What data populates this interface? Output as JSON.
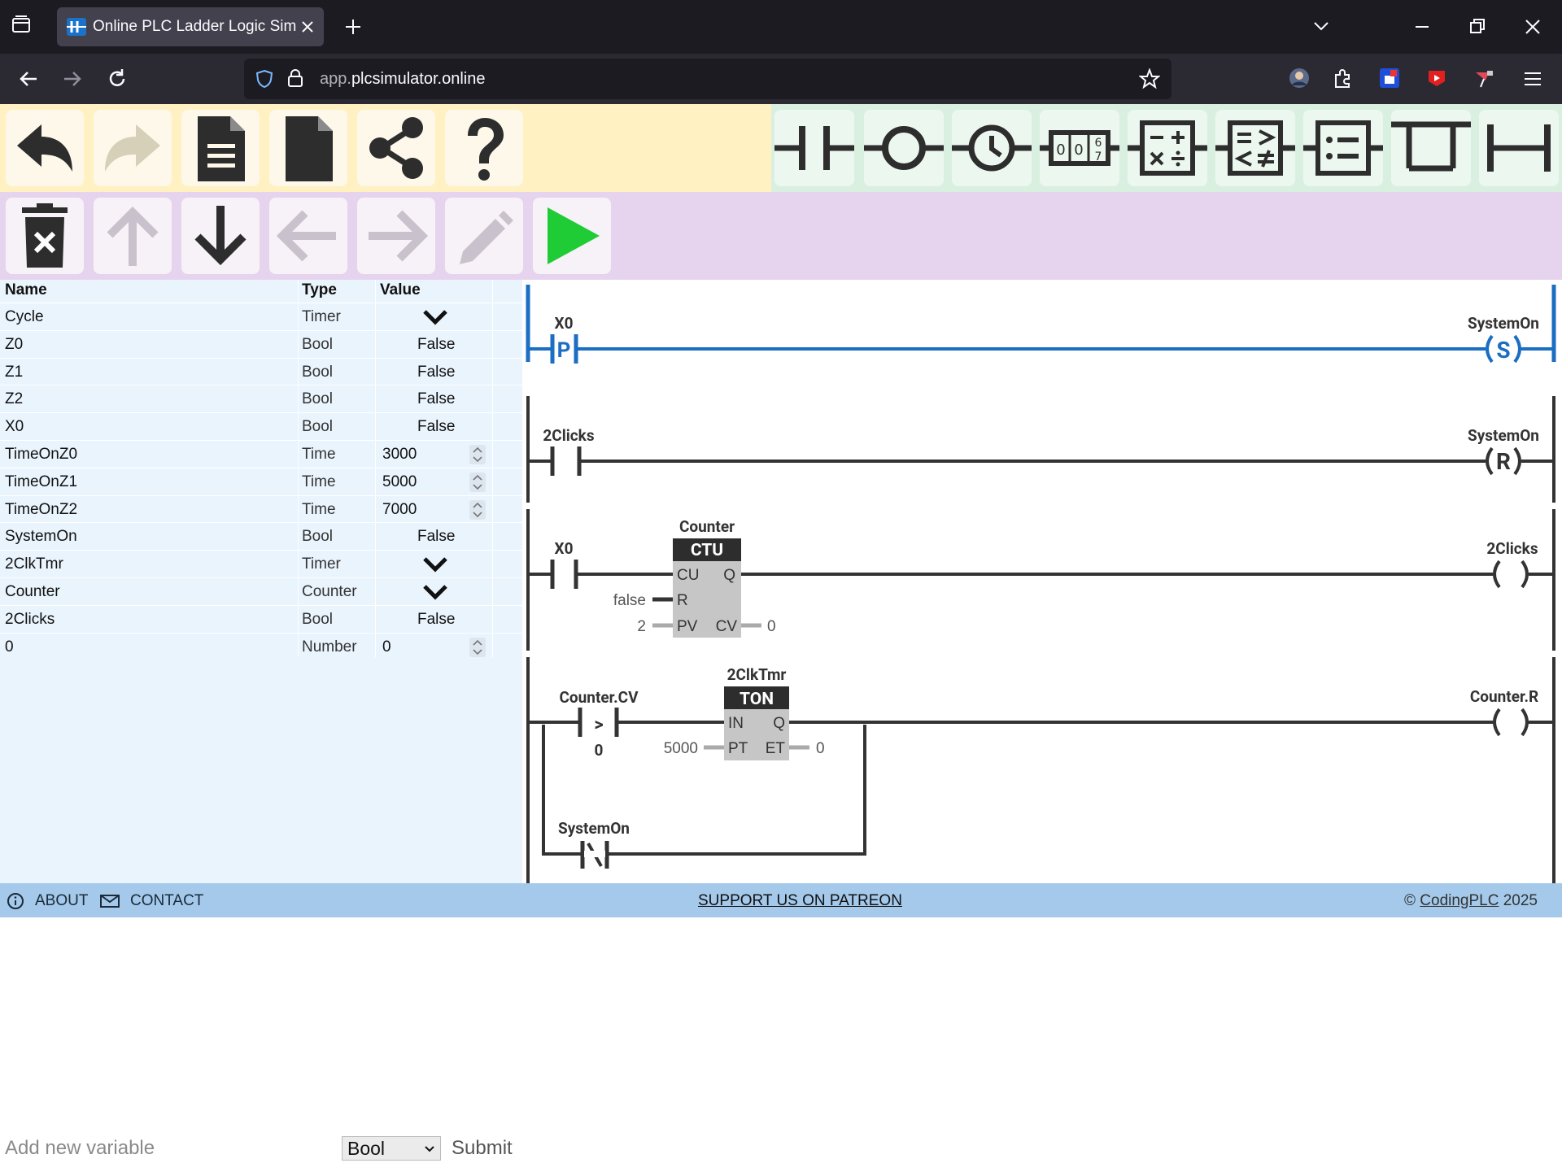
{
  "browser": {
    "tab_title": "Online PLC Ladder Logic Simula",
    "url_domain": "app.",
    "url_host": "plcsimulator.online"
  },
  "toolbar": {
    "row1_left": [
      "undo-icon",
      "redo-icon",
      "open-file-icon",
      "new-file-icon",
      "share-icon",
      "help-icon"
    ],
    "row1_right": [
      "contact-icon",
      "coil-icon",
      "timer-icon",
      "counter-icon",
      "math-icon",
      "compare-icon",
      "list-icon",
      "branch-icon",
      "wire-icon"
    ],
    "row2": [
      "delete-icon",
      "move-up-icon",
      "move-down-icon",
      "move-left-icon",
      "move-right-icon",
      "edit-icon",
      "run-icon"
    ],
    "disabled": [
      "redo-icon",
      "move-up-icon",
      "move-left-icon",
      "move-right-icon",
      "edit-icon"
    ],
    "run_color": "#1fcc35"
  },
  "variables": {
    "headers": {
      "name": "Name",
      "type": "Type",
      "value": "Value"
    },
    "rows": [
      {
        "name": "Cycle",
        "type": "Timer",
        "value": "",
        "kind": "expand"
      },
      {
        "name": "Z0",
        "type": "Bool",
        "value": "False",
        "kind": "bool"
      },
      {
        "name": "Z1",
        "type": "Bool",
        "value": "False",
        "kind": "bool"
      },
      {
        "name": "Z2",
        "type": "Bool",
        "value": "False",
        "kind": "bool"
      },
      {
        "name": "X0",
        "type": "Bool",
        "value": "False",
        "kind": "bool"
      },
      {
        "name": "TimeOnZ0",
        "type": "Time",
        "value": "3000",
        "kind": "number"
      },
      {
        "name": "TimeOnZ1",
        "type": "Time",
        "value": "5000",
        "kind": "number"
      },
      {
        "name": "TimeOnZ2",
        "type": "Time",
        "value": "7000",
        "kind": "number"
      },
      {
        "name": "SystemOn",
        "type": "Bool",
        "value": "False",
        "kind": "bool"
      },
      {
        "name": "2ClkTmr",
        "type": "Timer",
        "value": "",
        "kind": "expand"
      },
      {
        "name": "Counter",
        "type": "Counter",
        "value": "",
        "kind": "expand"
      },
      {
        "name": "2Clicks",
        "type": "Bool",
        "value": "False",
        "kind": "bool"
      },
      {
        "name": "0",
        "type": "Number",
        "value": "0",
        "kind": "number"
      }
    ],
    "add_placeholder": "Add new variable",
    "add_type": "Bool",
    "submit_label": "Submit"
  },
  "ladder": {
    "rung1": {
      "contact": "X0",
      "contact_mark": "P",
      "coil": "SystemOn",
      "coil_mark": "S"
    },
    "rung2": {
      "contact": "2Clicks",
      "coil": "SystemOn",
      "coil_mark": "R"
    },
    "rung3": {
      "contact": "X0",
      "block_name": "Counter",
      "block_type": "CTU",
      "in1": "CU",
      "out1": "Q",
      "in2": "R",
      "in3": "PV",
      "out3": "CV",
      "r_value": "false",
      "pv_value": "2",
      "cv_value": "0",
      "coil": "2Clicks"
    },
    "rung4": {
      "compare_var": "Counter.CV",
      "compare_op": ">",
      "compare_value": "0",
      "block_name": "2ClkTmr",
      "block_type": "TON",
      "in1": "IN",
      "out1": "Q",
      "in2": "PT",
      "out2": "ET",
      "pt_value": "5000",
      "et_value": "0",
      "coil": "Counter.R",
      "branch_contact": "SystemOn"
    },
    "active_color": "#1b6ec2"
  },
  "footer": {
    "about": "ABOUT",
    "contact": "CONTACT",
    "patreon": "SUPPORT US ON PATREON",
    "copyright_prefix": "© ",
    "copyright_link": "CodingPLC",
    "copyright_year": " 2025"
  }
}
